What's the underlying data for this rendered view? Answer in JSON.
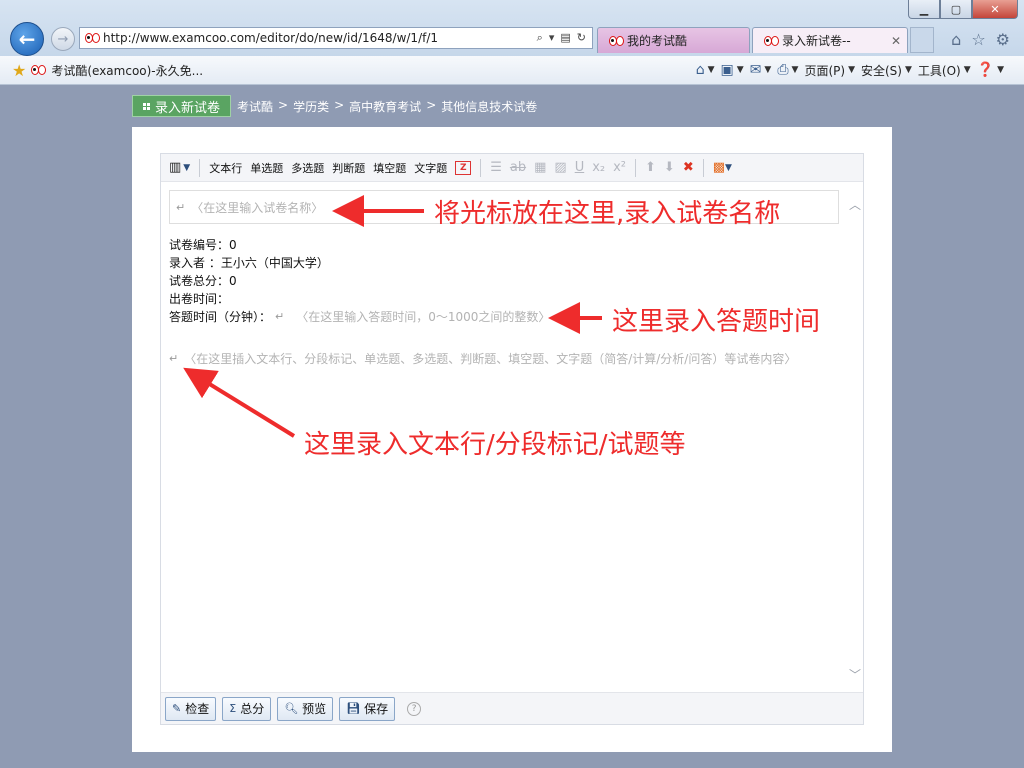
{
  "browser": {
    "url": "http://www.examcoo.com/editor/do/new/id/1648/w/1/f/1",
    "tabs": [
      {
        "label": "我的考试酷"
      },
      {
        "label": "录入新试卷--"
      }
    ],
    "favorite_title": "考试酷(examcoo)-永久免...",
    "commands": {
      "page": "页面(P)",
      "safety": "安全(S)",
      "tools": "工具(O)"
    }
  },
  "page": {
    "new_paper_button": "录入新试卷",
    "breadcrumbs": [
      "考试酷",
      ">",
      "学历类",
      ">",
      "高中教育考试",
      ">",
      "其他信息技术试卷"
    ]
  },
  "toolbar": {
    "items": [
      "文本行",
      "单选题",
      "多选题",
      "判断题",
      "填空题",
      "文字题"
    ]
  },
  "editor": {
    "title_placeholder": "〈在这里输入试卷名称〉",
    "return_mark": "↵",
    "paper_no_label": "试卷编号：",
    "paper_no_value": "0",
    "author_label": "录入者 ：",
    "author_value": "王小六（中国大学）",
    "total_label": "试卷总分：",
    "total_value": "0",
    "time_label": "出卷时间：",
    "duration_label": "答题时间（分钟）：",
    "duration_placeholder": "〈在这里输入答题时间，0～1000之间的整数〉",
    "body_placeholder": "〈在这里插入文本行、分段标记、单选题、多选题、判断题、填空题、文字题（简答/计算/分析/问答）等试卷内容〉"
  },
  "bottom_buttons": {
    "check": "检查",
    "total": "总分",
    "preview": "预览",
    "save": "保存",
    "help": "?"
  },
  "annotations": {
    "title_note": "将光标放在这里,录入试卷名称",
    "duration_note": "这里录入答题时间",
    "body_note": "这里录入文本行/分段标记/试题等"
  },
  "colors": {
    "annotation": "#ee2c2c",
    "new_paper_button": "#5aa462",
    "page_background": "#8f9bb3"
  }
}
